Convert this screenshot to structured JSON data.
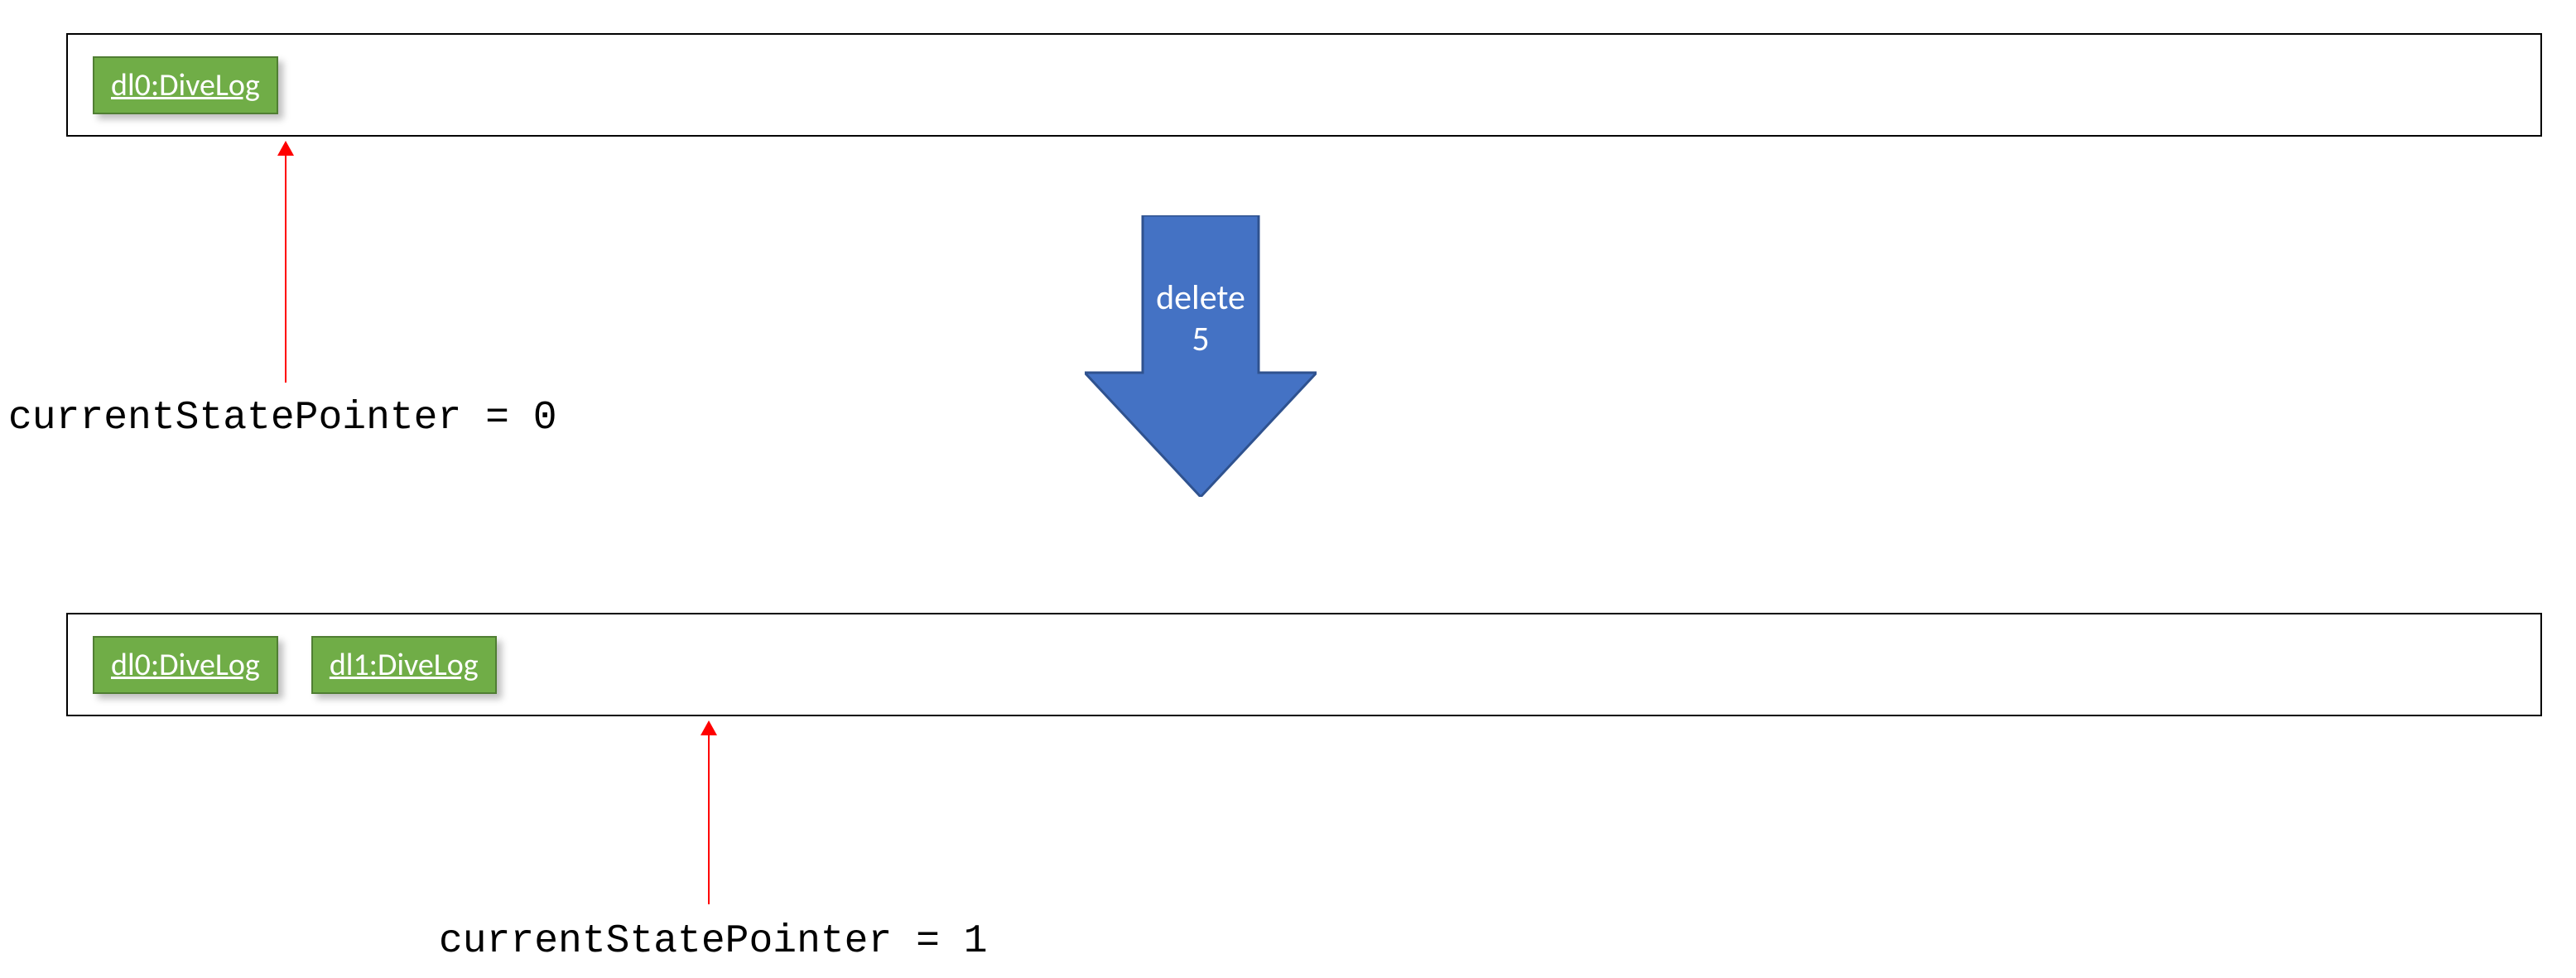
{
  "state_before": {
    "boxes": [
      {
        "label": "dl0:DiveLog"
      }
    ],
    "pointer_label": "currentStatePointer = 0"
  },
  "transition": {
    "label_line1": "delete",
    "label_line2": "5"
  },
  "state_after": {
    "boxes": [
      {
        "label": "dl0:DiveLog"
      },
      {
        "label": "dl1:DiveLog"
      }
    ],
    "pointer_label": "currentStatePointer = 1"
  },
  "colors": {
    "box_fill": "#70ad47",
    "box_border": "#507e33",
    "arrow_fill": "#4472c4",
    "arrow_border": "#2f528f",
    "pointer_arrow": "#ff0000"
  }
}
